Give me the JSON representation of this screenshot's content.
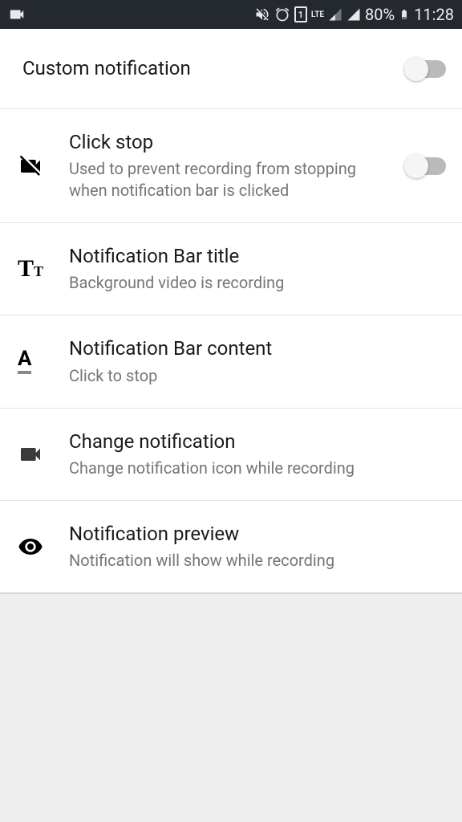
{
  "statusBar": {
    "battery": "80%",
    "time": "11:28",
    "lte": "LTE",
    "sim": "1"
  },
  "settings": {
    "customNotification": {
      "title": "Custom notification"
    },
    "clickStop": {
      "title": "Click stop",
      "subtitle": "Used to prevent recording from stopping when notification bar is clicked"
    },
    "barTitle": {
      "title": "Notification Bar title",
      "subtitle": "Background video is recording"
    },
    "barContent": {
      "title": "Notification Bar content",
      "subtitle": "Click to stop"
    },
    "changeNotification": {
      "title": "Change notification",
      "subtitle": "Change notification icon while recording"
    },
    "notificationPreview": {
      "title": "Notification preview",
      "subtitle": "Notification will show while recording"
    }
  }
}
